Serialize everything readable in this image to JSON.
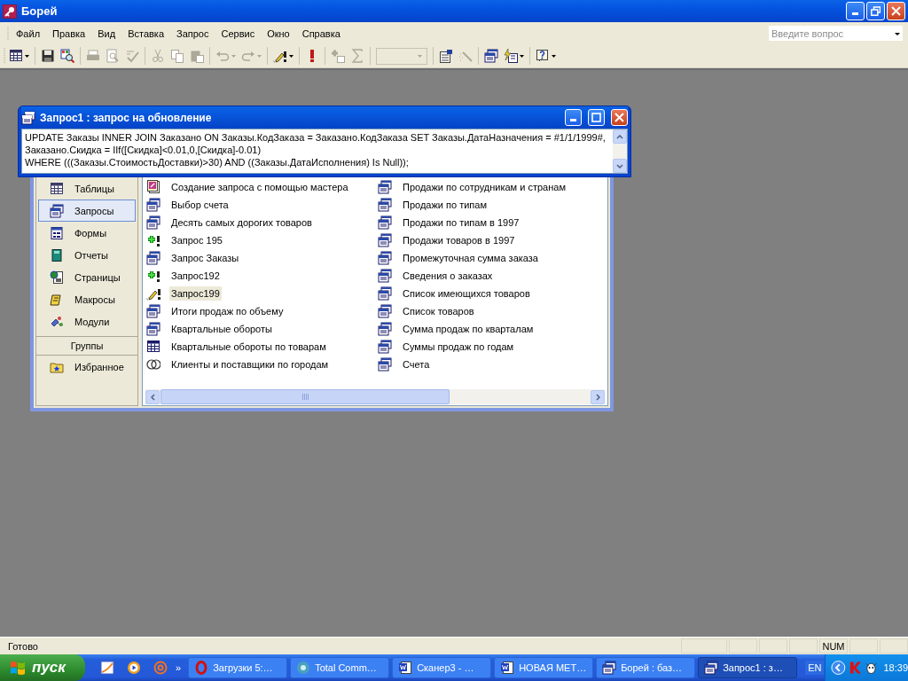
{
  "app_window": {
    "title": "Борей"
  },
  "menu": [
    "Файл",
    "Правка",
    "Вид",
    "Вставка",
    "Запрос",
    "Сервис",
    "Окно",
    "Справка"
  ],
  "ask_field": {
    "placeholder": "Введите вопрос"
  },
  "toolbar": [
    {
      "kind": "view",
      "disabled": false,
      "dropdown": true
    },
    {
      "kind": "sep"
    },
    {
      "kind": "save",
      "disabled": false,
      "dropdown": false
    },
    {
      "kind": "search",
      "disabled": false,
      "dropdown": false
    },
    {
      "kind": "sep"
    },
    {
      "kind": "print",
      "disabled": true,
      "dropdown": false
    },
    {
      "kind": "preview",
      "disabled": true,
      "dropdown": false
    },
    {
      "kind": "spelling",
      "disabled": true,
      "dropdown": false
    },
    {
      "kind": "sep"
    },
    {
      "kind": "cut",
      "disabled": true,
      "dropdown": false
    },
    {
      "kind": "copy",
      "disabled": true,
      "dropdown": false
    },
    {
      "kind": "paste",
      "disabled": true,
      "dropdown": false
    },
    {
      "kind": "sep"
    },
    {
      "kind": "undo",
      "disabled": true,
      "dropdown": true
    },
    {
      "kind": "redo",
      "disabled": true,
      "dropdown": true
    },
    {
      "kind": "sep"
    },
    {
      "kind": "query-type",
      "disabled": false,
      "dropdown": true
    },
    {
      "kind": "sep"
    },
    {
      "kind": "run",
      "disabled": false,
      "dropdown": false
    },
    {
      "kind": "sep"
    },
    {
      "kind": "show-table",
      "disabled": true,
      "dropdown": false
    },
    {
      "kind": "totals",
      "disabled": true,
      "dropdown": false
    },
    {
      "kind": "sep"
    },
    {
      "kind": "combo",
      "disabled": true,
      "dropdown": true
    },
    {
      "kind": "sep"
    },
    {
      "kind": "properties",
      "disabled": false,
      "dropdown": false
    },
    {
      "kind": "builder",
      "disabled": true,
      "dropdown": false
    },
    {
      "kind": "sep"
    },
    {
      "kind": "database-window",
      "disabled": false,
      "dropdown": false
    },
    {
      "kind": "new-object",
      "disabled": false,
      "dropdown": true
    },
    {
      "kind": "sep"
    },
    {
      "kind": "help",
      "disabled": false,
      "dropdown": true
    }
  ],
  "query_window": {
    "title": "Запрос1 : запрос на обновление",
    "sql_lines": [
      "UPDATE Заказы INNER JOIN Заказано ON Заказы.КодЗаказа = Заказано.КодЗаказа SET Заказы.ДатаНазначения = #1/1/1999#,",
      "Заказано.Скидка = IIf([Скидка]<0.01,0,[Скидка]-0.01)",
      "WHERE (((Заказы.СтоимостьДоставки)>30) AND ((Заказы.ДатаИсполнения) Is Null));"
    ]
  },
  "objects_bar": {
    "items": [
      {
        "kind": "tables",
        "label": "Таблицы",
        "selected": false
      },
      {
        "kind": "queries",
        "label": "Запросы",
        "selected": true
      },
      {
        "kind": "forms",
        "label": "Формы",
        "selected": false
      },
      {
        "kind": "reports",
        "label": "Отчеты",
        "selected": false
      },
      {
        "kind": "pages",
        "label": "Страницы",
        "selected": false
      },
      {
        "kind": "macros",
        "label": "Макросы",
        "selected": false
      },
      {
        "kind": "modules",
        "label": "Модули",
        "selected": false
      }
    ],
    "groups_header": "Группы",
    "groups": [
      {
        "kind": "favorites",
        "label": "Избранное",
        "selected": false
      }
    ]
  },
  "query_list": {
    "columns": [
      [
        {
          "kind": "wizard",
          "label": "Создание запроса с помощью мастера",
          "selected": false
        },
        {
          "kind": "select",
          "label": "Выбор счета",
          "selected": false
        },
        {
          "kind": "select",
          "label": "Десять самых дорогих товаров",
          "selected": false
        },
        {
          "kind": "append",
          "label": "Запрос 195",
          "selected": false
        },
        {
          "kind": "select",
          "label": "Запрос Заказы",
          "selected": false
        },
        {
          "kind": "append",
          "label": "Запрос192",
          "selected": false
        },
        {
          "kind": "update",
          "label": "Запрос199",
          "selected": true
        },
        {
          "kind": "select",
          "label": "Итоги продаж по объему",
          "selected": false
        },
        {
          "kind": "select",
          "label": "Квартальные обороты",
          "selected": false
        },
        {
          "kind": "crosstab",
          "label": "Квартальные обороты по товарам",
          "selected": false
        },
        {
          "kind": "union",
          "label": "Клиенты и поставщики по городам",
          "selected": false
        }
      ],
      [
        {
          "kind": "select",
          "label": "Продажи по сотрудникам и странам",
          "selected": false
        },
        {
          "kind": "select",
          "label": "Продажи по типам",
          "selected": false
        },
        {
          "kind": "select",
          "label": "Продажи по типам в 1997",
          "selected": false
        },
        {
          "kind": "select",
          "label": "Продажи товаров в 1997",
          "selected": false
        },
        {
          "kind": "select",
          "label": "Промежуточная сумма заказа",
          "selected": false
        },
        {
          "kind": "select",
          "label": "Сведения о заказах",
          "selected": false
        },
        {
          "kind": "select",
          "label": "Список имеющихся товаров",
          "selected": false
        },
        {
          "kind": "select",
          "label": "Список товаров",
          "selected": false
        },
        {
          "kind": "select",
          "label": "Сумма продаж по кварталам",
          "selected": false
        },
        {
          "kind": "select",
          "label": "Суммы продаж по годам",
          "selected": false
        },
        {
          "kind": "select",
          "label": "Счета",
          "selected": false
        }
      ]
    ]
  },
  "status_bar": {
    "text": "Готово",
    "indicator": "NUM"
  },
  "taskbar": {
    "start": "пуск",
    "quick_launch_more": "»",
    "tasks": [
      {
        "kind": "opera",
        "label": "Загрузки 5:…",
        "selected": false
      },
      {
        "kind": "commander",
        "label": "Total Comm…",
        "selected": false
      },
      {
        "kind": "word",
        "label": "Сканер3 - …",
        "selected": false
      },
      {
        "kind": "word",
        "label": "НОВАЯ МЕТ…",
        "selected": false
      },
      {
        "kind": "access-db",
        "label": "Борей : баз…",
        "selected": false
      },
      {
        "kind": "access-query",
        "label": "Запрос1 : з…",
        "selected": true
      }
    ],
    "language": "EN",
    "clock": "18:39"
  }
}
